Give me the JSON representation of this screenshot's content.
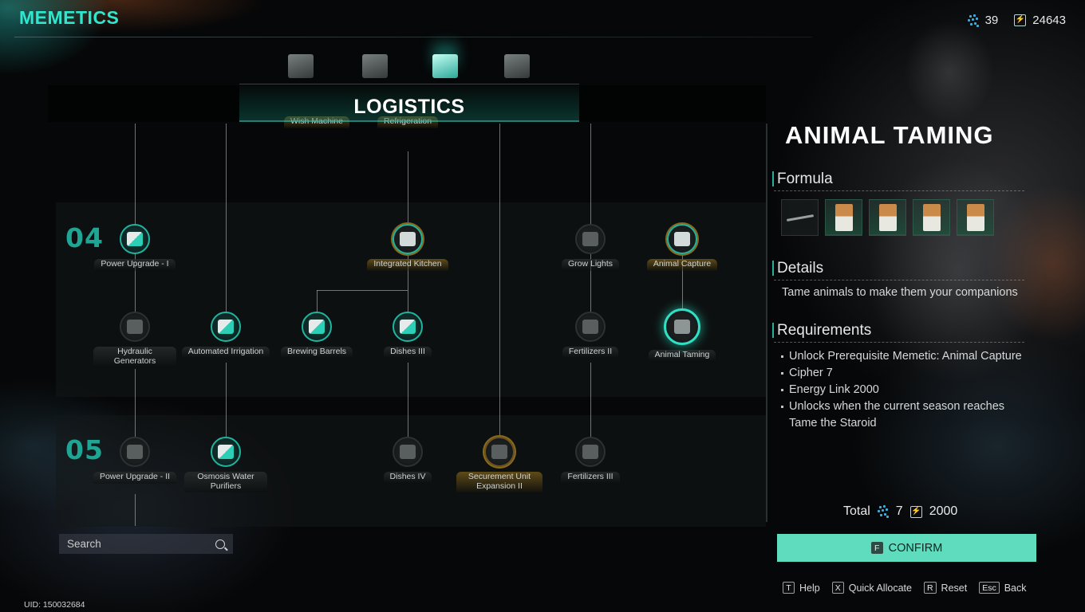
{
  "app": {
    "title": "MEMETICS",
    "currencies": [
      {
        "icon": "cipher-icon",
        "value": "39"
      },
      {
        "icon": "energy-link-icon",
        "value": "24643"
      }
    ]
  },
  "category_tabs": [
    {
      "id": "combat",
      "icon": "weapon-icon",
      "active": false
    },
    {
      "id": "crafting",
      "icon": "workbench-icon",
      "active": false
    },
    {
      "id": "logistics",
      "icon": "tree-planter-icon",
      "active": true
    },
    {
      "id": "building",
      "icon": "house-icon",
      "active": false
    }
  ],
  "section_title": "LOGISTICS",
  "tree": {
    "top_row": [
      {
        "label": "Wish Machine",
        "state": "owned"
      },
      {
        "label": "Refrigeration",
        "state": "owned"
      }
    ],
    "tiers": [
      {
        "number": "04",
        "nodes": [
          {
            "label": "Power Upgrade - I",
            "state": "unlocked",
            "icon": "generator-icon"
          },
          {
            "label": "Integrated Kitchen",
            "state": "owned",
            "icon": "frying-pan-icon"
          },
          {
            "label": "Grow Lights",
            "state": "locked",
            "icon": "grow-light-icon"
          },
          {
            "label": "Animal Capture",
            "state": "owned",
            "icon": "capture-device-icon"
          },
          {
            "label": "Hydraulic Generators",
            "state": "locked",
            "icon": "water-wheel-icon"
          },
          {
            "label": "Automated Irrigation",
            "state": "unlocked",
            "icon": "sprinkler-icon"
          },
          {
            "label": "Brewing Barrels",
            "state": "unlocked",
            "icon": "brewing-barrel-icon"
          },
          {
            "label": "Dishes III",
            "state": "unlocked",
            "icon": "steak-icon"
          },
          {
            "label": "Fertilizers II",
            "state": "locked",
            "icon": "fertilizer-bag-icon"
          },
          {
            "label": "Animal Taming",
            "state": "selected",
            "icon": "capture-device-icon"
          }
        ]
      },
      {
        "number": "05",
        "nodes": [
          {
            "label": "Power Upgrade - II",
            "state": "locked",
            "icon": "generator-icon"
          },
          {
            "label": "Osmosis Water Purifiers",
            "state": "unlocked",
            "icon": "water-purifier-icon"
          },
          {
            "label": "Dishes IV",
            "state": "locked",
            "icon": "steak-icon"
          },
          {
            "label": "Securement Unit Expansion II",
            "state": "locked-gold",
            "icon": "storage-unit-icon"
          },
          {
            "label": "Fertilizers III",
            "state": "locked",
            "icon": "fertilizer-bag-icon"
          }
        ]
      }
    ]
  },
  "search": {
    "placeholder": "Search",
    "value": ""
  },
  "uid": "UID: 150032684",
  "detail": {
    "title": "ANIMAL TAMING",
    "formula_heading": "Formula",
    "formula_items": [
      {
        "icon": "rifle-icon",
        "rarity": "common"
      },
      {
        "icon": "feed-bag-icon",
        "rarity": "uncommon"
      },
      {
        "icon": "feed-bag-icon",
        "rarity": "uncommon"
      },
      {
        "icon": "feed-bag-icon",
        "rarity": "uncommon"
      },
      {
        "icon": "feed-bag-icon",
        "rarity": "uncommon"
      }
    ],
    "details_heading": "Details",
    "details_text": "Tame animals to make them your companions",
    "requirements_heading": "Requirements",
    "requirements": [
      "Unlock Prerequisite Memetic:  Animal Capture",
      "Cipher 7",
      "Energy Link 2000",
      "Unlocks when the current season reaches Tame the Staroid"
    ],
    "total_label": "Total",
    "total_cipher": "7",
    "total_energy": "2000",
    "confirm": {
      "key": "F",
      "label": "CONFIRM"
    }
  },
  "hints": [
    {
      "key": "T",
      "label": "Help"
    },
    {
      "key": "X",
      "label": "Quick Allocate"
    },
    {
      "key": "R",
      "label": "Reset"
    },
    {
      "key": "Esc",
      "label": "Back"
    }
  ],
  "colors": {
    "accent": "#2fe6cf",
    "confirm": "#5fdcbe",
    "tier_number": "#1fa593",
    "owned_gold": "#8a6a1c"
  }
}
